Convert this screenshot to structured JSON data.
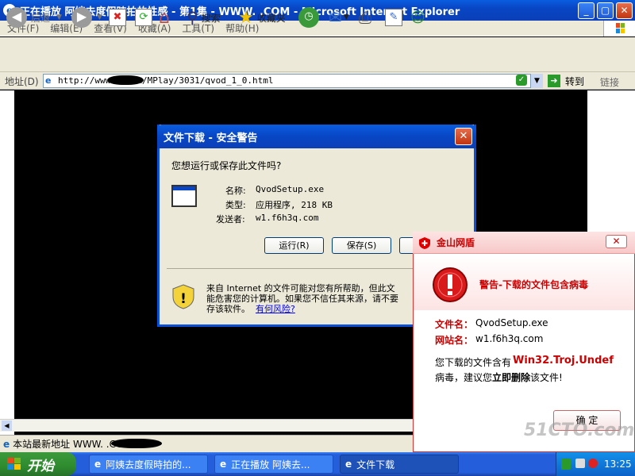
{
  "browser": {
    "title": "正在播放 阿姨去度假時拍的性感 - 第1集 - WWW. .COM - Microsoft Internet Explorer",
    "menu": [
      "文件(F)",
      "编辑(E)",
      "查看(V)",
      "收藏(A)",
      "工具(T)",
      "帮助(H)"
    ],
    "toolbar": {
      "back": "后退",
      "search": "搜索",
      "favorites": "收藏夹"
    },
    "address_label": "地址(D)",
    "address_value": "http://www.        .com/MPlay/3031/qvod_1_0.html",
    "go_label": "转到",
    "links_label": "链接",
    "status_text": "本站最新地址 WWW.        .COM"
  },
  "download_dialog": {
    "title": "文件下载 - 安全警告",
    "question": "您想运行或保存此文件吗?",
    "name_label": "名称:",
    "name_value": "QvodSetup.exe",
    "type_label": "类型:",
    "type_value": "应用程序, 218 KB",
    "from_label": "发送者:",
    "from_value": "w1.f6h3q.com",
    "run_button": "运行(R)",
    "save_button": "保存(S)",
    "warning_line1": "来自 Internet 的文件可能对您有所帮助，但此文",
    "warning_line2": "能危害您的计算机。如果您不信任其来源，请不要",
    "warning_line3": "存该软件。",
    "risk_link": "有何风险?"
  },
  "kingsoft": {
    "title": "金山网盾",
    "headline": "警告-下载的文件包含病毒",
    "file_label": "文件名：",
    "file_value": "QvodSetup.exe",
    "site_label": "网站名：",
    "site_value": "w1.f6h3q.com",
    "msg_prefix": "您下载的文件含有",
    "virus_name": "Win32.Troj.Undef",
    "msg_line2_a": "病毒，建议您",
    "msg_line2_b": "立即删除",
    "msg_line2_c": "该文件!",
    "ok_button": "确 定"
  },
  "taskbar": {
    "start": "开始",
    "tasks": [
      "阿姨去度假時拍的...",
      "正在播放 阿姨去...",
      "文件下载"
    ],
    "clock": "13:25"
  },
  "watermark": "51CTO.com",
  "colors": {
    "xp_blue": "#0a5de0",
    "ks_red": "#c00000",
    "link_blue": "#0000ee"
  }
}
